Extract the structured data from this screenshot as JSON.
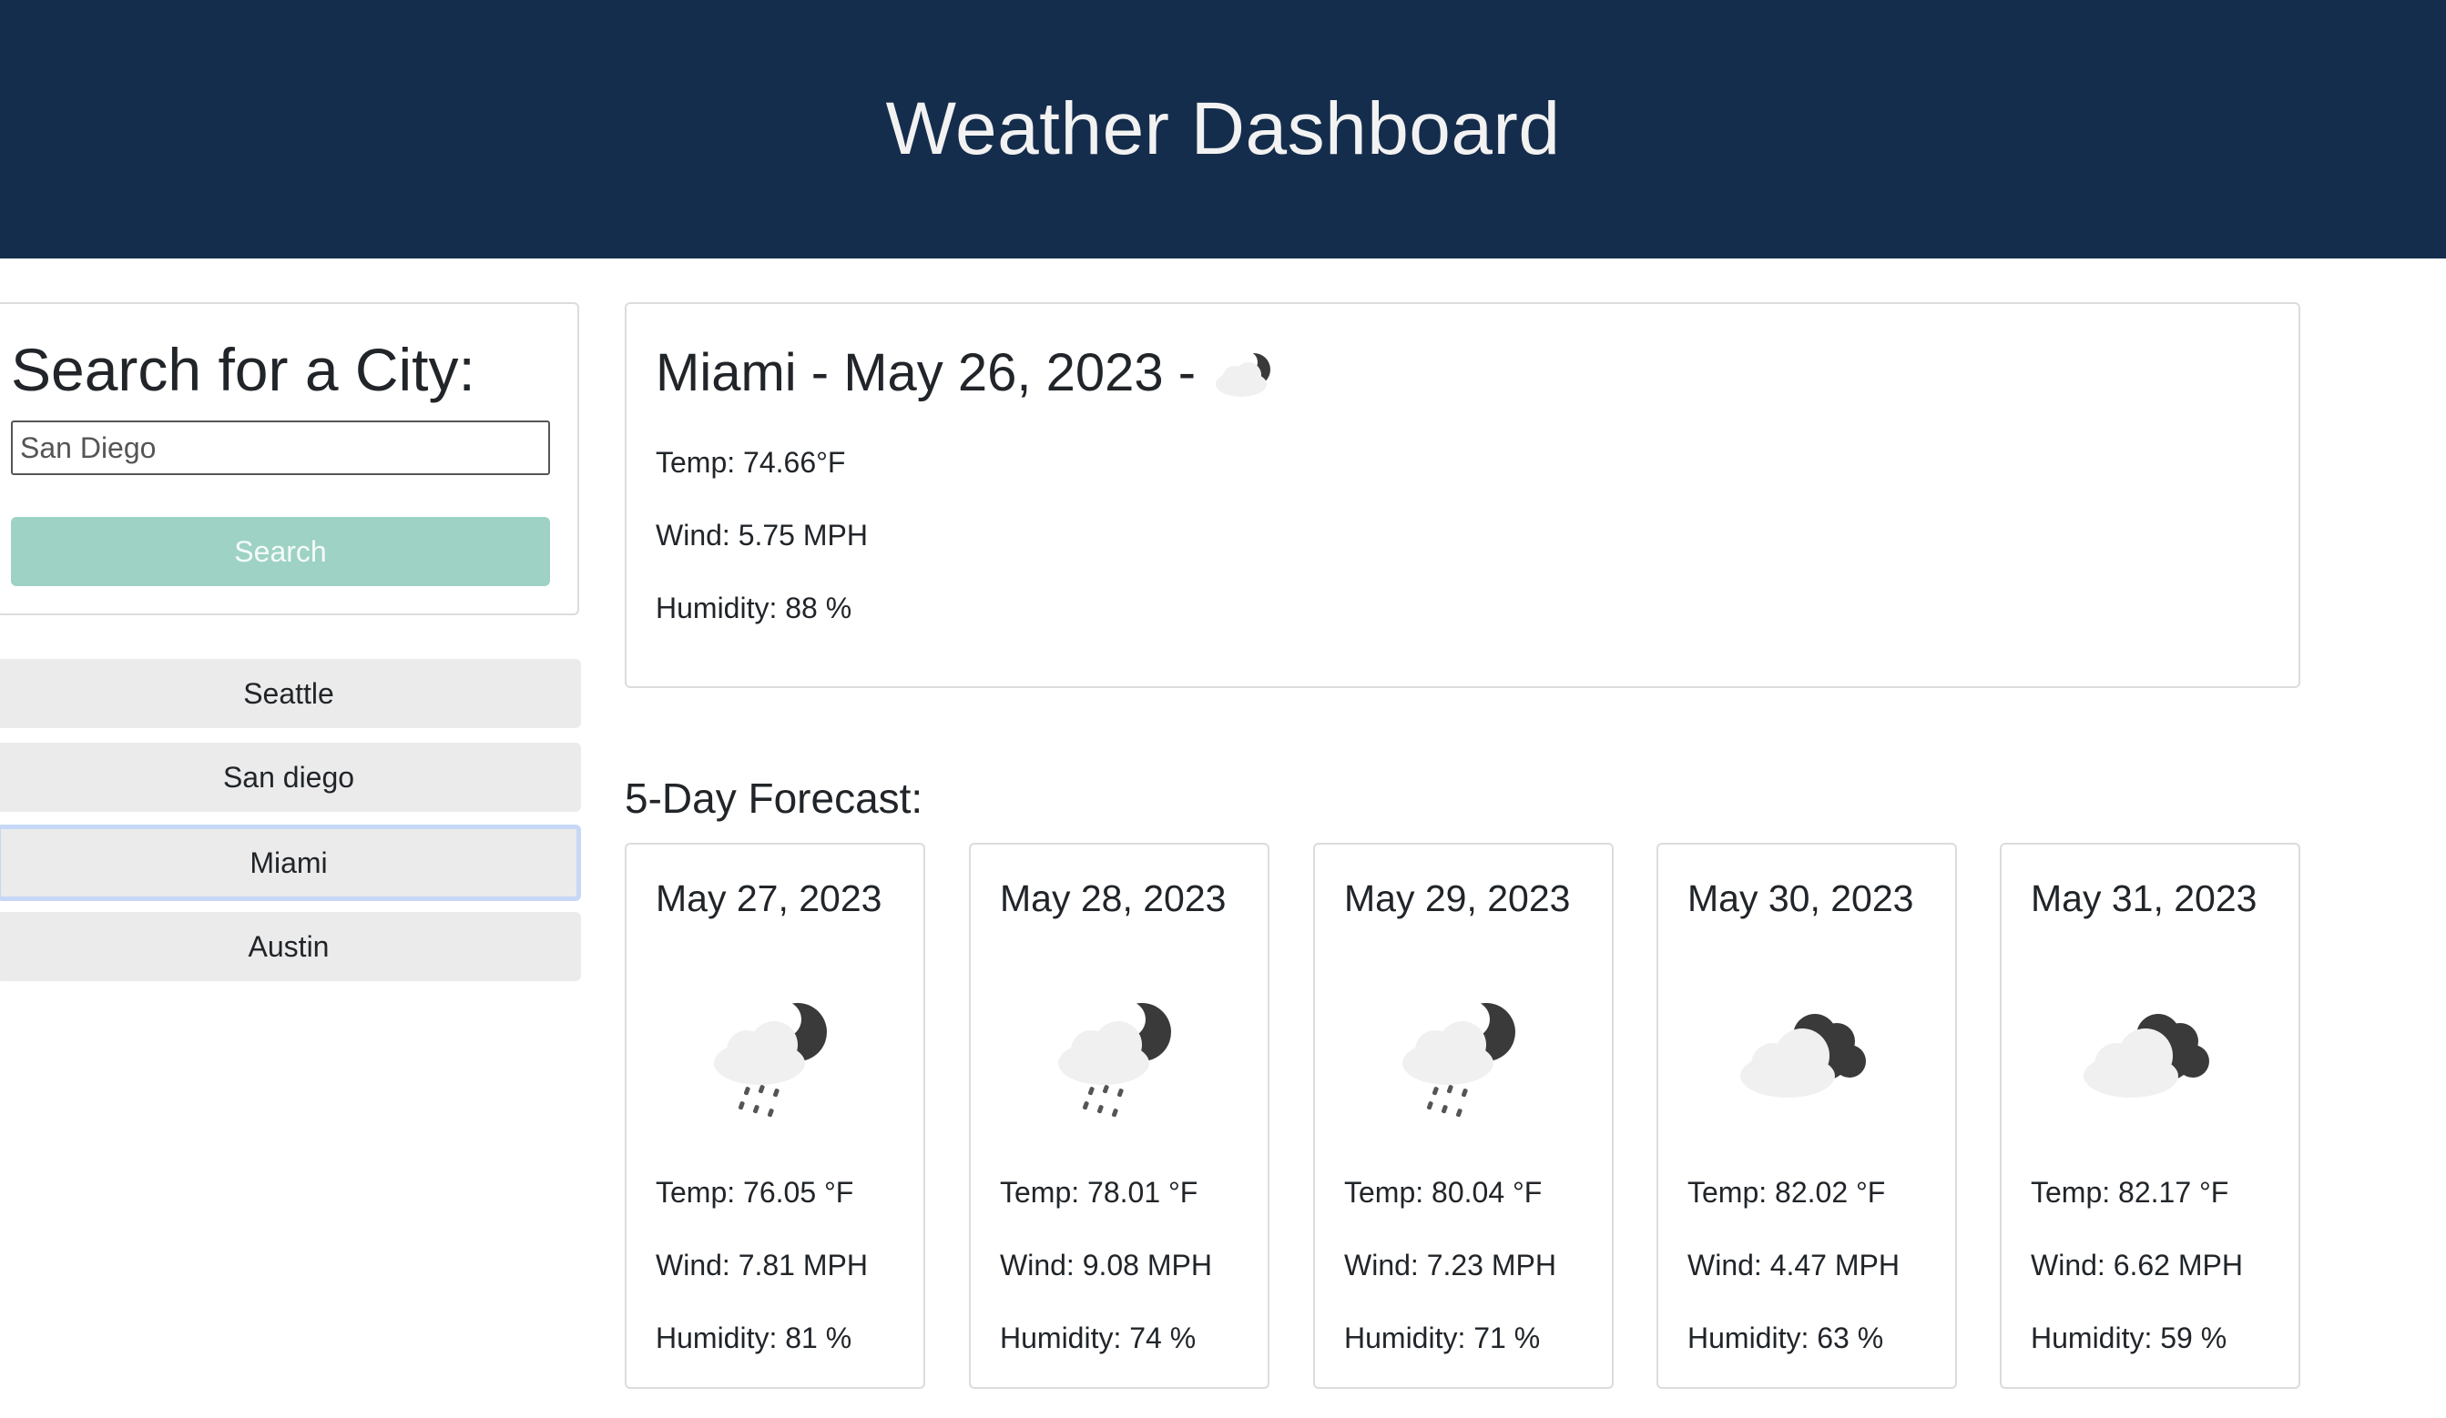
{
  "header": {
    "title": "Weather Dashboard"
  },
  "search": {
    "heading": "Search for a City:",
    "input_value": "San Diego",
    "button_label": "Search"
  },
  "history": [
    {
      "label": "Seattle",
      "active": false
    },
    {
      "label": "San diego",
      "active": false
    },
    {
      "label": "Miami",
      "active": true
    },
    {
      "label": "Austin",
      "active": false
    }
  ],
  "current": {
    "title": "Miami - May 26, 2023 -",
    "icon": "partly-cloudy-night-icon",
    "temp": "Temp: 74.66°F",
    "wind": "Wind: 5.75 MPH",
    "humidity": "Humidity: 88 %"
  },
  "forecast": {
    "heading": "5-Day Forecast:",
    "days": [
      {
        "date": "May 27, 2023",
        "icon": "rain-night-icon",
        "temp": "Temp: 76.05 °F",
        "wind": "Wind: 7.81 MPH",
        "humidity": "Humidity: 81 %"
      },
      {
        "date": "May 28, 2023",
        "icon": "rain-night-icon",
        "temp": "Temp: 78.01 °F",
        "wind": "Wind: 9.08 MPH",
        "humidity": "Humidity: 74 %"
      },
      {
        "date": "May 29, 2023",
        "icon": "rain-night-icon",
        "temp": "Temp: 80.04 °F",
        "wind": "Wind: 7.23 MPH",
        "humidity": "Humidity: 71 %"
      },
      {
        "date": "May 30, 2023",
        "icon": "broken-clouds-icon",
        "temp": "Temp: 82.02 °F",
        "wind": "Wind: 4.47 MPH",
        "humidity": "Humidity: 63 %"
      },
      {
        "date": "May 31, 2023",
        "icon": "broken-clouds-icon",
        "temp": "Temp: 82.17 °F",
        "wind": "Wind: 6.62 MPH",
        "humidity": "Humidity: 59 %"
      }
    ]
  },
  "colors": {
    "header_bg": "#152d4c",
    "search_button_bg": "#9dd2c4",
    "history_bg": "#ebebeb",
    "active_outline": "#c6d8f6"
  }
}
